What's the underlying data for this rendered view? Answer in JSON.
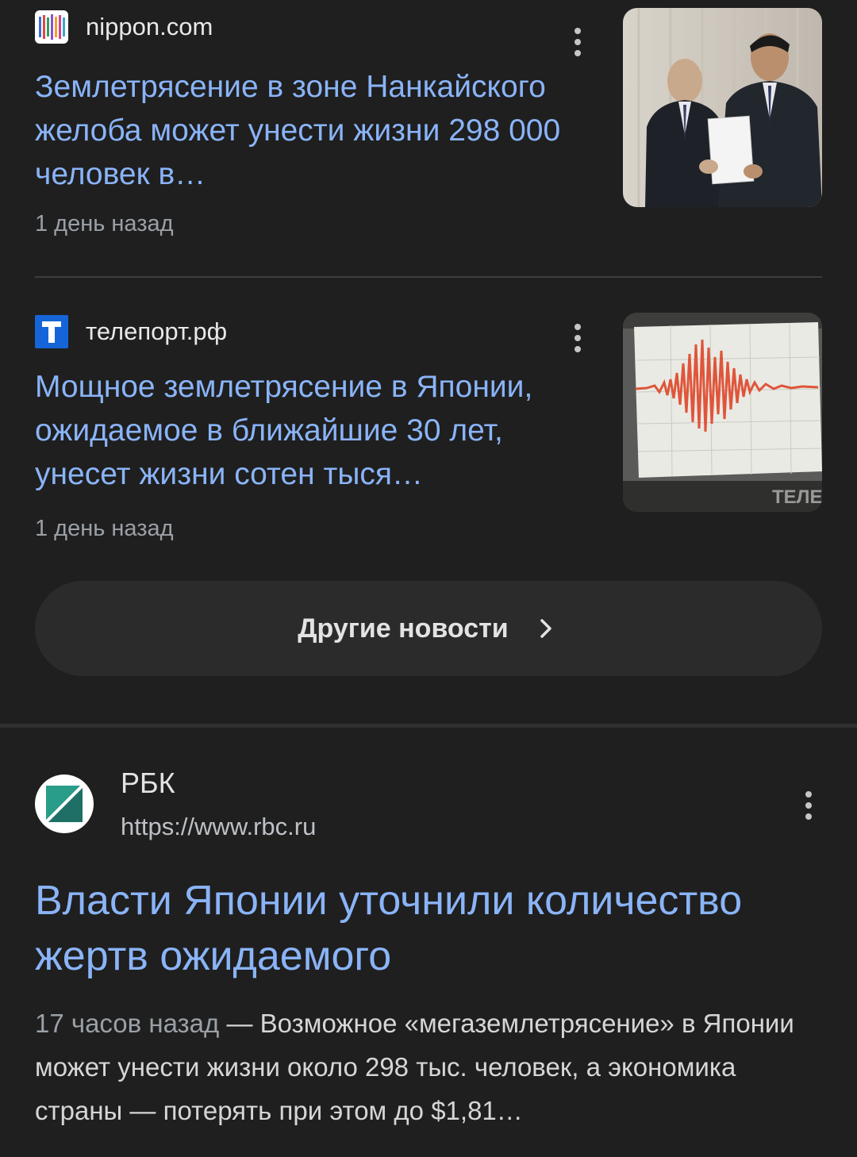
{
  "news": [
    {
      "source": "nippon.com",
      "title": "Землетрясение в зоне Нанкайского желоба может унести жизни 298 000 человек в…",
      "time": "1 день назад"
    },
    {
      "source": "телепорт.рф",
      "title": "Мощное землетрясение в Японии, ожидаемое в ближайшие 30 лет, унесет жизни сотен тыся…",
      "time": "1 день назад",
      "thumb_watermark": "ТЕЛЕП"
    }
  ],
  "more_news": {
    "label": "Другие новости"
  },
  "result": {
    "site_name": "РБК",
    "url": "https://www.rbc.ru",
    "title": "Власти Японии уточнили количество жертв ожидаемого",
    "time": "17 часов назад",
    "snippet": " — Возможное «мегаземлетрясение» в Японии может унести жизни около 298 тыс. человек, а экономика страны — потерять при этом до $1,81…"
  },
  "colors": {
    "link": "#8ab4f8",
    "background": "#1f1f1f",
    "muted": "#9aa0a6"
  },
  "icons": {
    "menu": "more-vert-icon",
    "chevron": "chevron-right-icon"
  }
}
